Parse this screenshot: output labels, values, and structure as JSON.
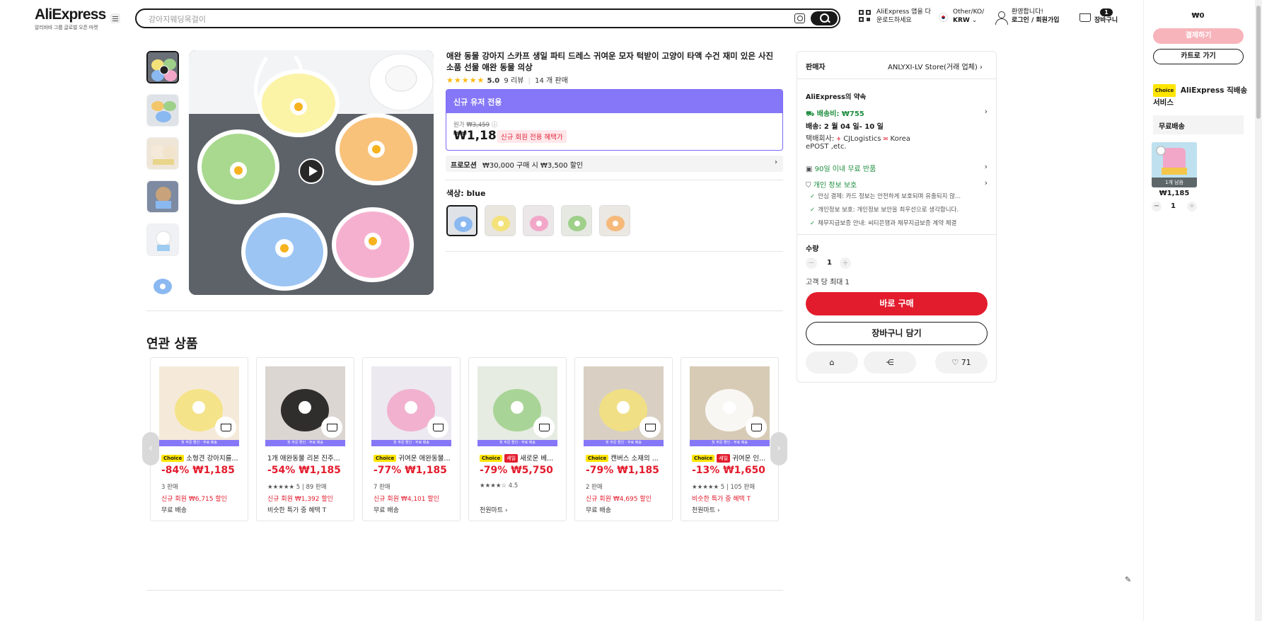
{
  "header": {
    "logo": "AliExpress",
    "logo_sub": "알리바바 그룹 글로벌 오픈 마켓",
    "search_placeholder": "강아지웨딩목걸이",
    "app_line1": "AliExpress 앱을 다",
    "app_line2": "운로드하세요",
    "region_line1": "Other/KO/",
    "region_line2": "KRW",
    "welcome": "환영합니다!",
    "login": "로그인 / 회원가입",
    "cart_count": "1",
    "cart_label": "장바구니"
  },
  "product": {
    "title": "애완 동물 강아지 스카프 생일 파티 드레스 귀여운 모자 턱받이 고양이 타액 수건 재미 있은 사진 소품 선물 애완 동물 의상",
    "rating": "5.0",
    "reviews": "9 리뷰",
    "sold": "14 개 판매",
    "promo_header": "신규 유저 전용",
    "orig_label": "원가",
    "orig_price": "₩3,459",
    "price": "₩1,185",
    "price_tag": "신규 회원 전용 혜택가",
    "promotion_label": "프로모션",
    "promotion_text": "₩30,000 구매 시 ₩3,500 할인",
    "color_label": "색상:",
    "color_value": "blue"
  },
  "buybox": {
    "seller_label": "판매자",
    "seller_name": "ANLYXI-LV Store(거래 업체)",
    "promise": "AliExpress의 약속",
    "shipping_fee": "배송비: ₩755",
    "delivery": "배송: 2 월 04 일- 10 일",
    "courier_label": "택배회사:",
    "courier_1": "CJLogistics",
    "courier_2": "Korea",
    "courier_3": "ePOST ,etc.",
    "return": "90일 이내 무료 반품",
    "privacy": "개인 정보 보호",
    "check_1": "안심 결제: 카드 정보는 안전하게 보호되며 유출되지 않...",
    "check_2": "개인정보 보호: 개인정보 보안을 최우선으로 생각합니다.",
    "check_3": "채무지급보증 안내: 씨티은행과 채무지급보증 계약 체결",
    "qty_label": "수량",
    "qty_value": "1",
    "max_per_customer": "고객 당 최대 1",
    "buy_now": "바로 구매",
    "add_to_cart": "장바구니 담기",
    "wishlist_count": "71"
  },
  "related": {
    "title": "연관 상품",
    "band_text": "첫 주문 할인 · 무료 배송",
    "items": [
      {
        "title": "소형견 강아지를...",
        "choice": true,
        "sale": false,
        "price": "-84% ₩1,185",
        "line1": "3 판매",
        "line2": "신규 회원 ₩6,715 할인",
        "line3": "무료 배송"
      },
      {
        "title": "1개 애완동물 리본 진주...",
        "choice": false,
        "sale": false,
        "price": "-54% ₩1,185",
        "line1": "★★★★★ 5 | 89 판매",
        "line2": "신규 회원 ₩1,392 할인",
        "line3": "비슷한 특가 중 혜택 T"
      },
      {
        "title": "귀여운 애완동물...",
        "choice": true,
        "sale": false,
        "price": "-77% ₩1,185",
        "line1": "7 판매",
        "line2": "신규 회원 ₩4,101 할인",
        "line3": "무료 배송"
      },
      {
        "title": "새로운 베...",
        "choice": true,
        "sale": true,
        "price": "-79% ₩5,750",
        "line1": "★★★★☆ 4.5",
        "line2": "",
        "line3": "천원마트 ›"
      },
      {
        "title": "캔버스 소재의 ...",
        "choice": true,
        "sale": false,
        "price": "-79% ₩1,185",
        "line1": "2 판매",
        "line2": "신규 회원 ₩4,695 할인",
        "line3": "무료 배송"
      },
      {
        "title": "귀여운 인...",
        "choice": true,
        "sale": true,
        "price": "-13% ₩1,650",
        "line1": "★★★★★ 5 | 105 판매",
        "line2": "비슷한 특가 중 혜택 T",
        "line3": "천원마트 ›"
      }
    ]
  },
  "side_cart": {
    "total": "₩0",
    "checkout": "결제하기",
    "go_cart": "카트로 가기",
    "choice_badge": "Choice",
    "service": "AliExpress 직배송 서비스",
    "free_shipping": "무료배송",
    "items_left": "1개 남음",
    "item_price": "₩1,185",
    "item_qty": "1"
  },
  "labels": {
    "choice": "Choice",
    "sale": "세일"
  },
  "colors": {
    "accent_red": "#e31c2d",
    "promo_purple": "#8577f7",
    "choice_yellow": "#ffe500",
    "green": "#1e8e3e"
  }
}
